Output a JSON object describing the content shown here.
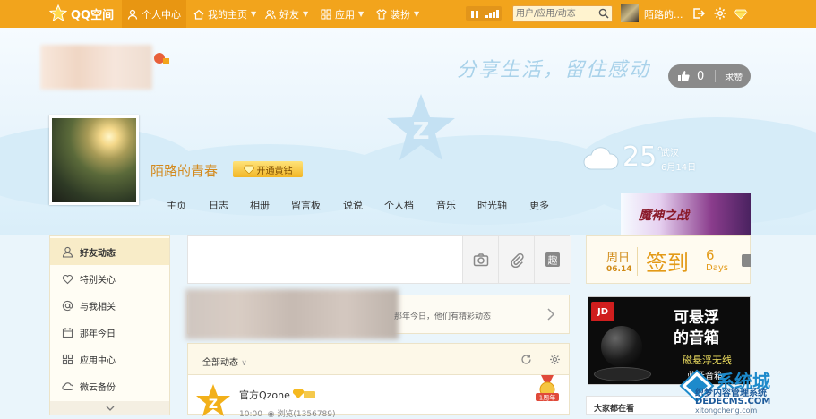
{
  "topbar": {
    "brand": "QQ空间",
    "nav": [
      {
        "label": "个人中心",
        "active": true
      },
      {
        "label": "我的主页",
        "dropdown": true
      },
      {
        "label": "好友",
        "dropdown": true
      },
      {
        "label": "应用",
        "dropdown": true
      },
      {
        "label": "装扮",
        "dropdown": true
      }
    ],
    "search_placeholder": "用户/应用/动态",
    "username": "陌路的..."
  },
  "banner": {
    "slogan": "分享生活，留住感动",
    "like_count": "0",
    "like_request": "求赞",
    "profile_name": "陌路的青春",
    "vip_label": "开通黄钻",
    "weather": {
      "temp": "25",
      "degree": "°",
      "city": "武汉",
      "date": "6月14日"
    },
    "tabs": [
      "主页",
      "日志",
      "相册",
      "留言板",
      "说说",
      "个人档",
      "音乐",
      "时光轴",
      "更多"
    ],
    "game_ad_text": "魔神之战"
  },
  "sidebar": {
    "items": [
      {
        "label": "好友动态",
        "icon": "friends-icon",
        "active": true
      },
      {
        "label": "特别关心",
        "icon": "heart-icon"
      },
      {
        "label": "与我相关",
        "icon": "at-icon"
      },
      {
        "label": "那年今日",
        "icon": "calendar-icon"
      },
      {
        "label": "应用中心",
        "icon": "grid-icon"
      },
      {
        "label": "微云备份",
        "icon": "cloud-icon"
      }
    ]
  },
  "feed": {
    "notice_text": "那年今日，他们有精彩动态",
    "filter_label": "全部动态",
    "post": {
      "author": "官方Qzone",
      "time": "10:00",
      "views": "浏览(1356789)",
      "medal_text": "1周年"
    }
  },
  "checkin": {
    "weekday": "周日",
    "date": "06.14",
    "label": "签到",
    "days": "6",
    "days_label": "Days"
  },
  "ad": {
    "brand": "JD",
    "line1": "可悬浮",
    "line2": "的音箱",
    "line3": "磁悬浮无线",
    "line4": "蓝牙音箱"
  },
  "right_bottom_title": "大家都在看",
  "watermark": {
    "t1": "系统城",
    "t2": "织梦内容管理系统",
    "t3": "DEDECMS.COM",
    "t4": "xitongcheng.com"
  }
}
